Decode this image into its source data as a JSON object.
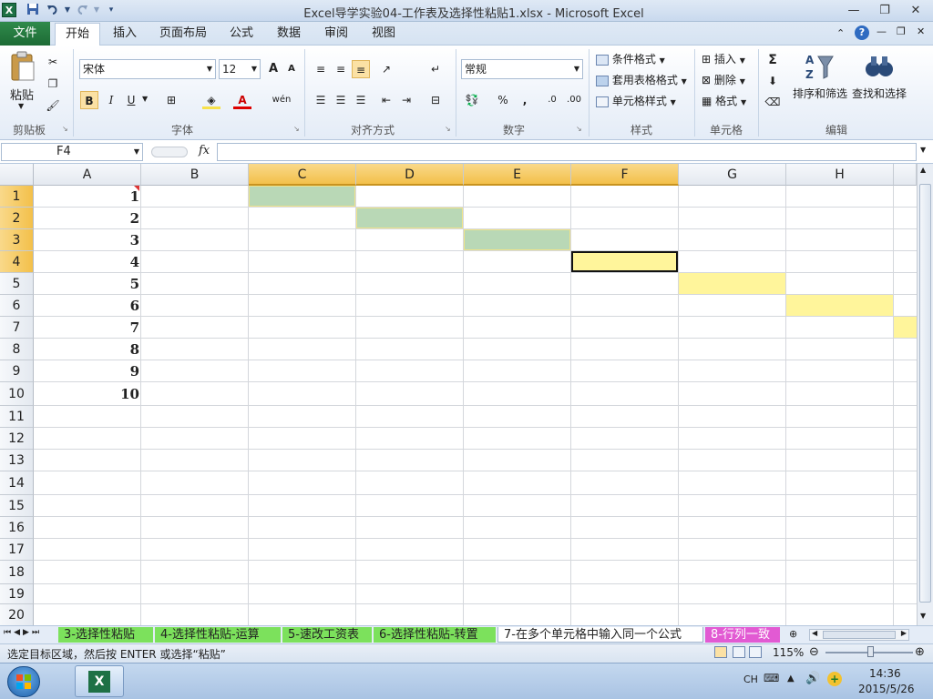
{
  "window": {
    "title": "Excel导学实验04-工作表及选择性粘贴1.xlsx - Microsoft Excel",
    "app_icon": "X",
    "qat_icons": [
      "save-icon",
      "undo-icon",
      "redo-icon",
      "customize-qat-icon"
    ]
  },
  "tabs": [
    {
      "label": "文件"
    },
    {
      "label": "开始"
    },
    {
      "label": "插入"
    },
    {
      "label": "页面布局"
    },
    {
      "label": "公式"
    },
    {
      "label": "数据"
    },
    {
      "label": "审阅"
    },
    {
      "label": "视图"
    }
  ],
  "ribbon": {
    "clipboard": {
      "paste": "粘贴",
      "label": "剪贴板"
    },
    "font": {
      "name": "宋体",
      "size": "12",
      "bold": "B",
      "italic": "I",
      "underline": "U",
      "grow": "A",
      "shrink": "A",
      "wen": "wén",
      "label": "字体"
    },
    "alignment": {
      "label": "对齐方式"
    },
    "number": {
      "format": "常规",
      "percent": "%",
      "comma": ",",
      "inc": ".0",
      "dec": ".00",
      "label": "数字"
    },
    "styles": {
      "conditional": "条件格式",
      "table": "套用表格格式",
      "cell": "单元格样式",
      "label": "样式"
    },
    "cells": {
      "insert": "插入",
      "delete": "删除",
      "format": "格式",
      "label": "单元格"
    },
    "editing": {
      "sum": "Σ",
      "sort": "排序和筛选",
      "find": "查找和选择",
      "label": "编辑"
    }
  },
  "formula_bar": {
    "name_box": "F4",
    "fx": "fx",
    "content": ""
  },
  "grid": {
    "columns": [
      "A",
      "B",
      "C",
      "D",
      "E",
      "F",
      "G",
      "H"
    ],
    "rows": [
      "1",
      "2",
      "3",
      "4",
      "5",
      "6",
      "7",
      "8",
      "9",
      "10",
      "11",
      "12",
      "13",
      "14",
      "15",
      "16",
      "17",
      "18",
      "19",
      "20"
    ],
    "column_a_values": [
      "1",
      "2",
      "3",
      "4",
      "5",
      "6",
      "7",
      "8",
      "9",
      "10"
    ],
    "active_cell": "F4",
    "green_fill": "#b9d8b6",
    "yellow_fill": "#fff59b"
  },
  "sheet_tabs": [
    {
      "label": "3-选择性粘贴"
    },
    {
      "label": "4-选择性粘贴-运算"
    },
    {
      "label": "5-速改工资表"
    },
    {
      "label": "6-选择性粘贴-转置"
    },
    {
      "label": "7-在多个单元格中输入同一个公式"
    },
    {
      "label": "8-行列一致"
    }
  ],
  "status": {
    "message": "选定目标区域，然后按 ENTER 或选择“粘贴”",
    "zoom": "115%"
  },
  "taskbar": {
    "lang": "CH",
    "time": "14:36",
    "date": "2015/5/26"
  }
}
